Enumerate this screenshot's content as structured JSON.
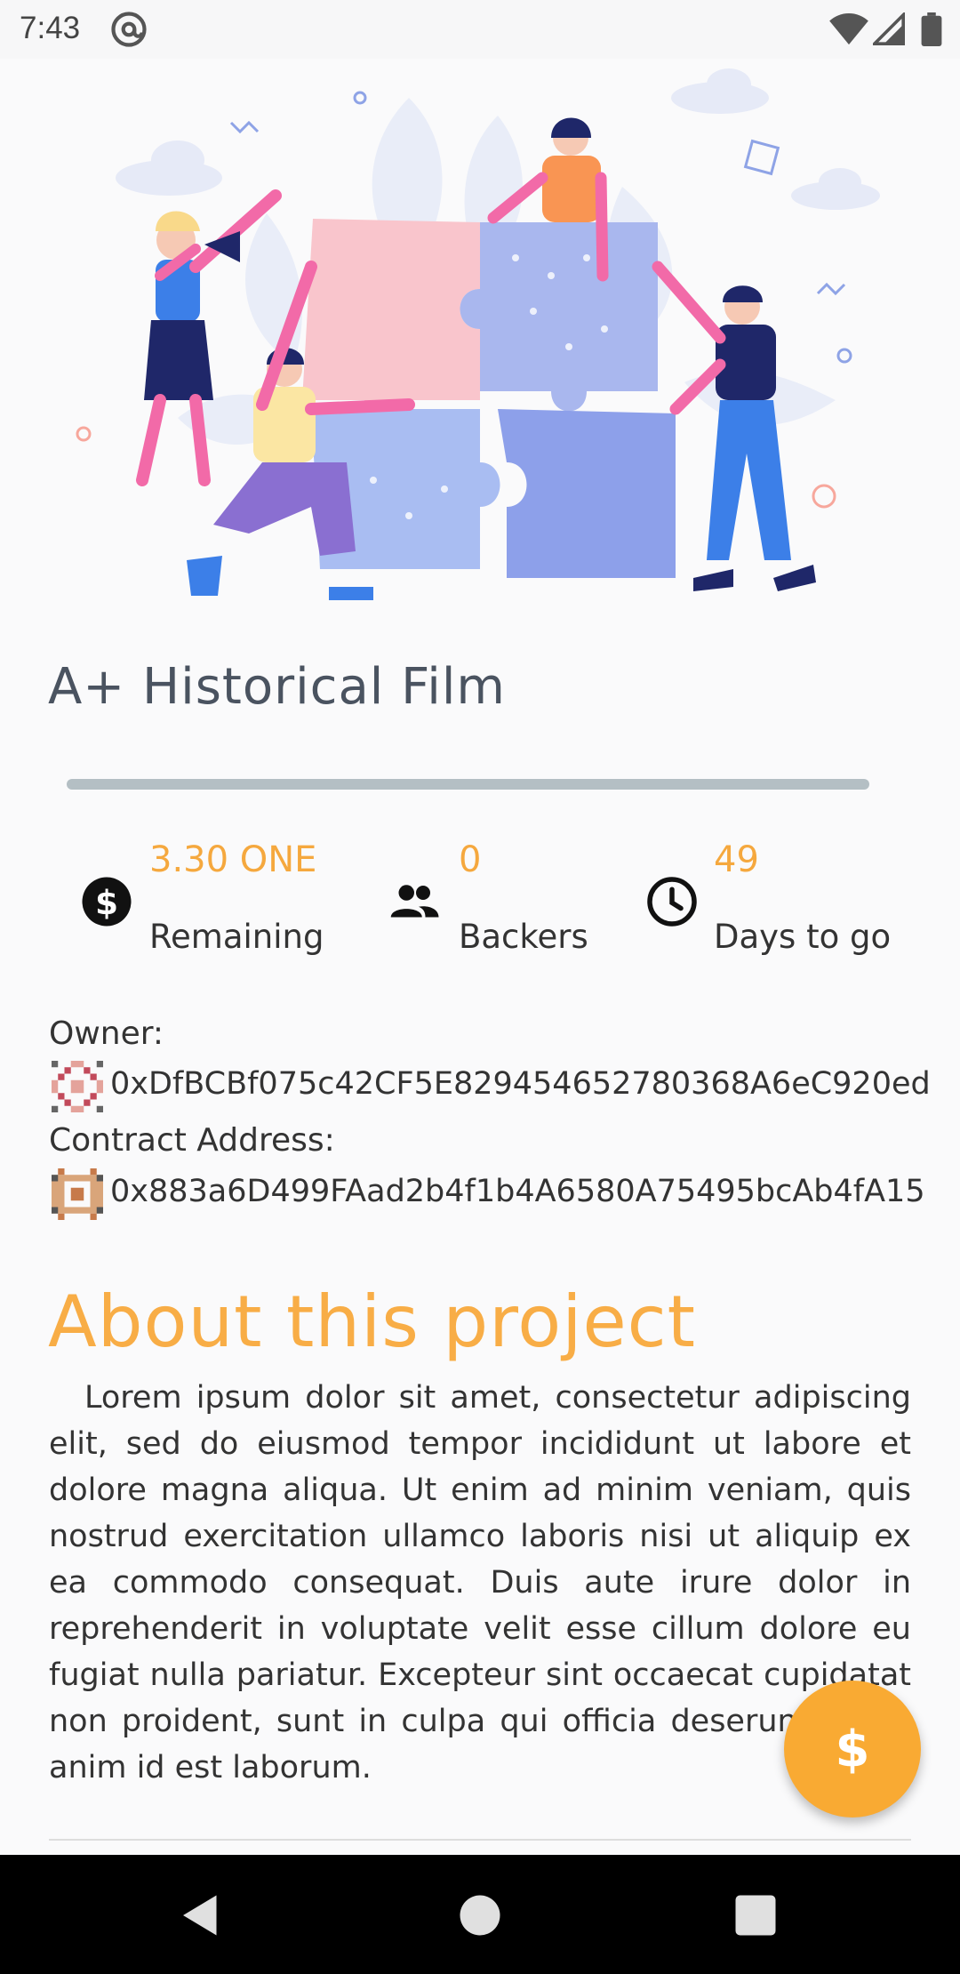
{
  "status_bar": {
    "time": "7:43"
  },
  "project": {
    "title": "A+ Historical Film",
    "progress_fraction": 0.0
  },
  "stats": [
    {
      "value": "3.30 ONE",
      "label": "Remaining",
      "icon": "dollar-circle-icon"
    },
    {
      "value": "0",
      "label": "Backers",
      "icon": "people-icon"
    },
    {
      "value": "49",
      "label": "Days to go",
      "icon": "clock-icon"
    }
  ],
  "owner": {
    "label": "Owner:",
    "address": "0xDfBCBf075c42CF5E829454652780368A6eC920ed"
  },
  "contract": {
    "label": "Contract Address:",
    "address": "0x883a6D499FAad2b4f1b4A6580A75495bcAb4fA15"
  },
  "about": {
    "heading": "About this project",
    "text": "Lorem ipsum dolor sit amet, consectetur adipiscing elit, sed do eiusmod tempor incididunt ut labore et dolore magna aliqua. Ut enim ad minim veniam, quis nostrud exercitation ullamco laboris nisi ut aliquip ex ea commodo consequat. Duis aute irure dolor in reprehenderit in voluptate velit esse cillum dolore eu fugiat nulla pariatur. Excepteur sint occaecat cupidatat non proident, sunt in culpa qui officia deserunt mollit anim id est laborum."
  },
  "fab": {
    "label": "$"
  },
  "colors": {
    "accent": "#f9aa33",
    "progress_track": "#b4bfc4"
  }
}
